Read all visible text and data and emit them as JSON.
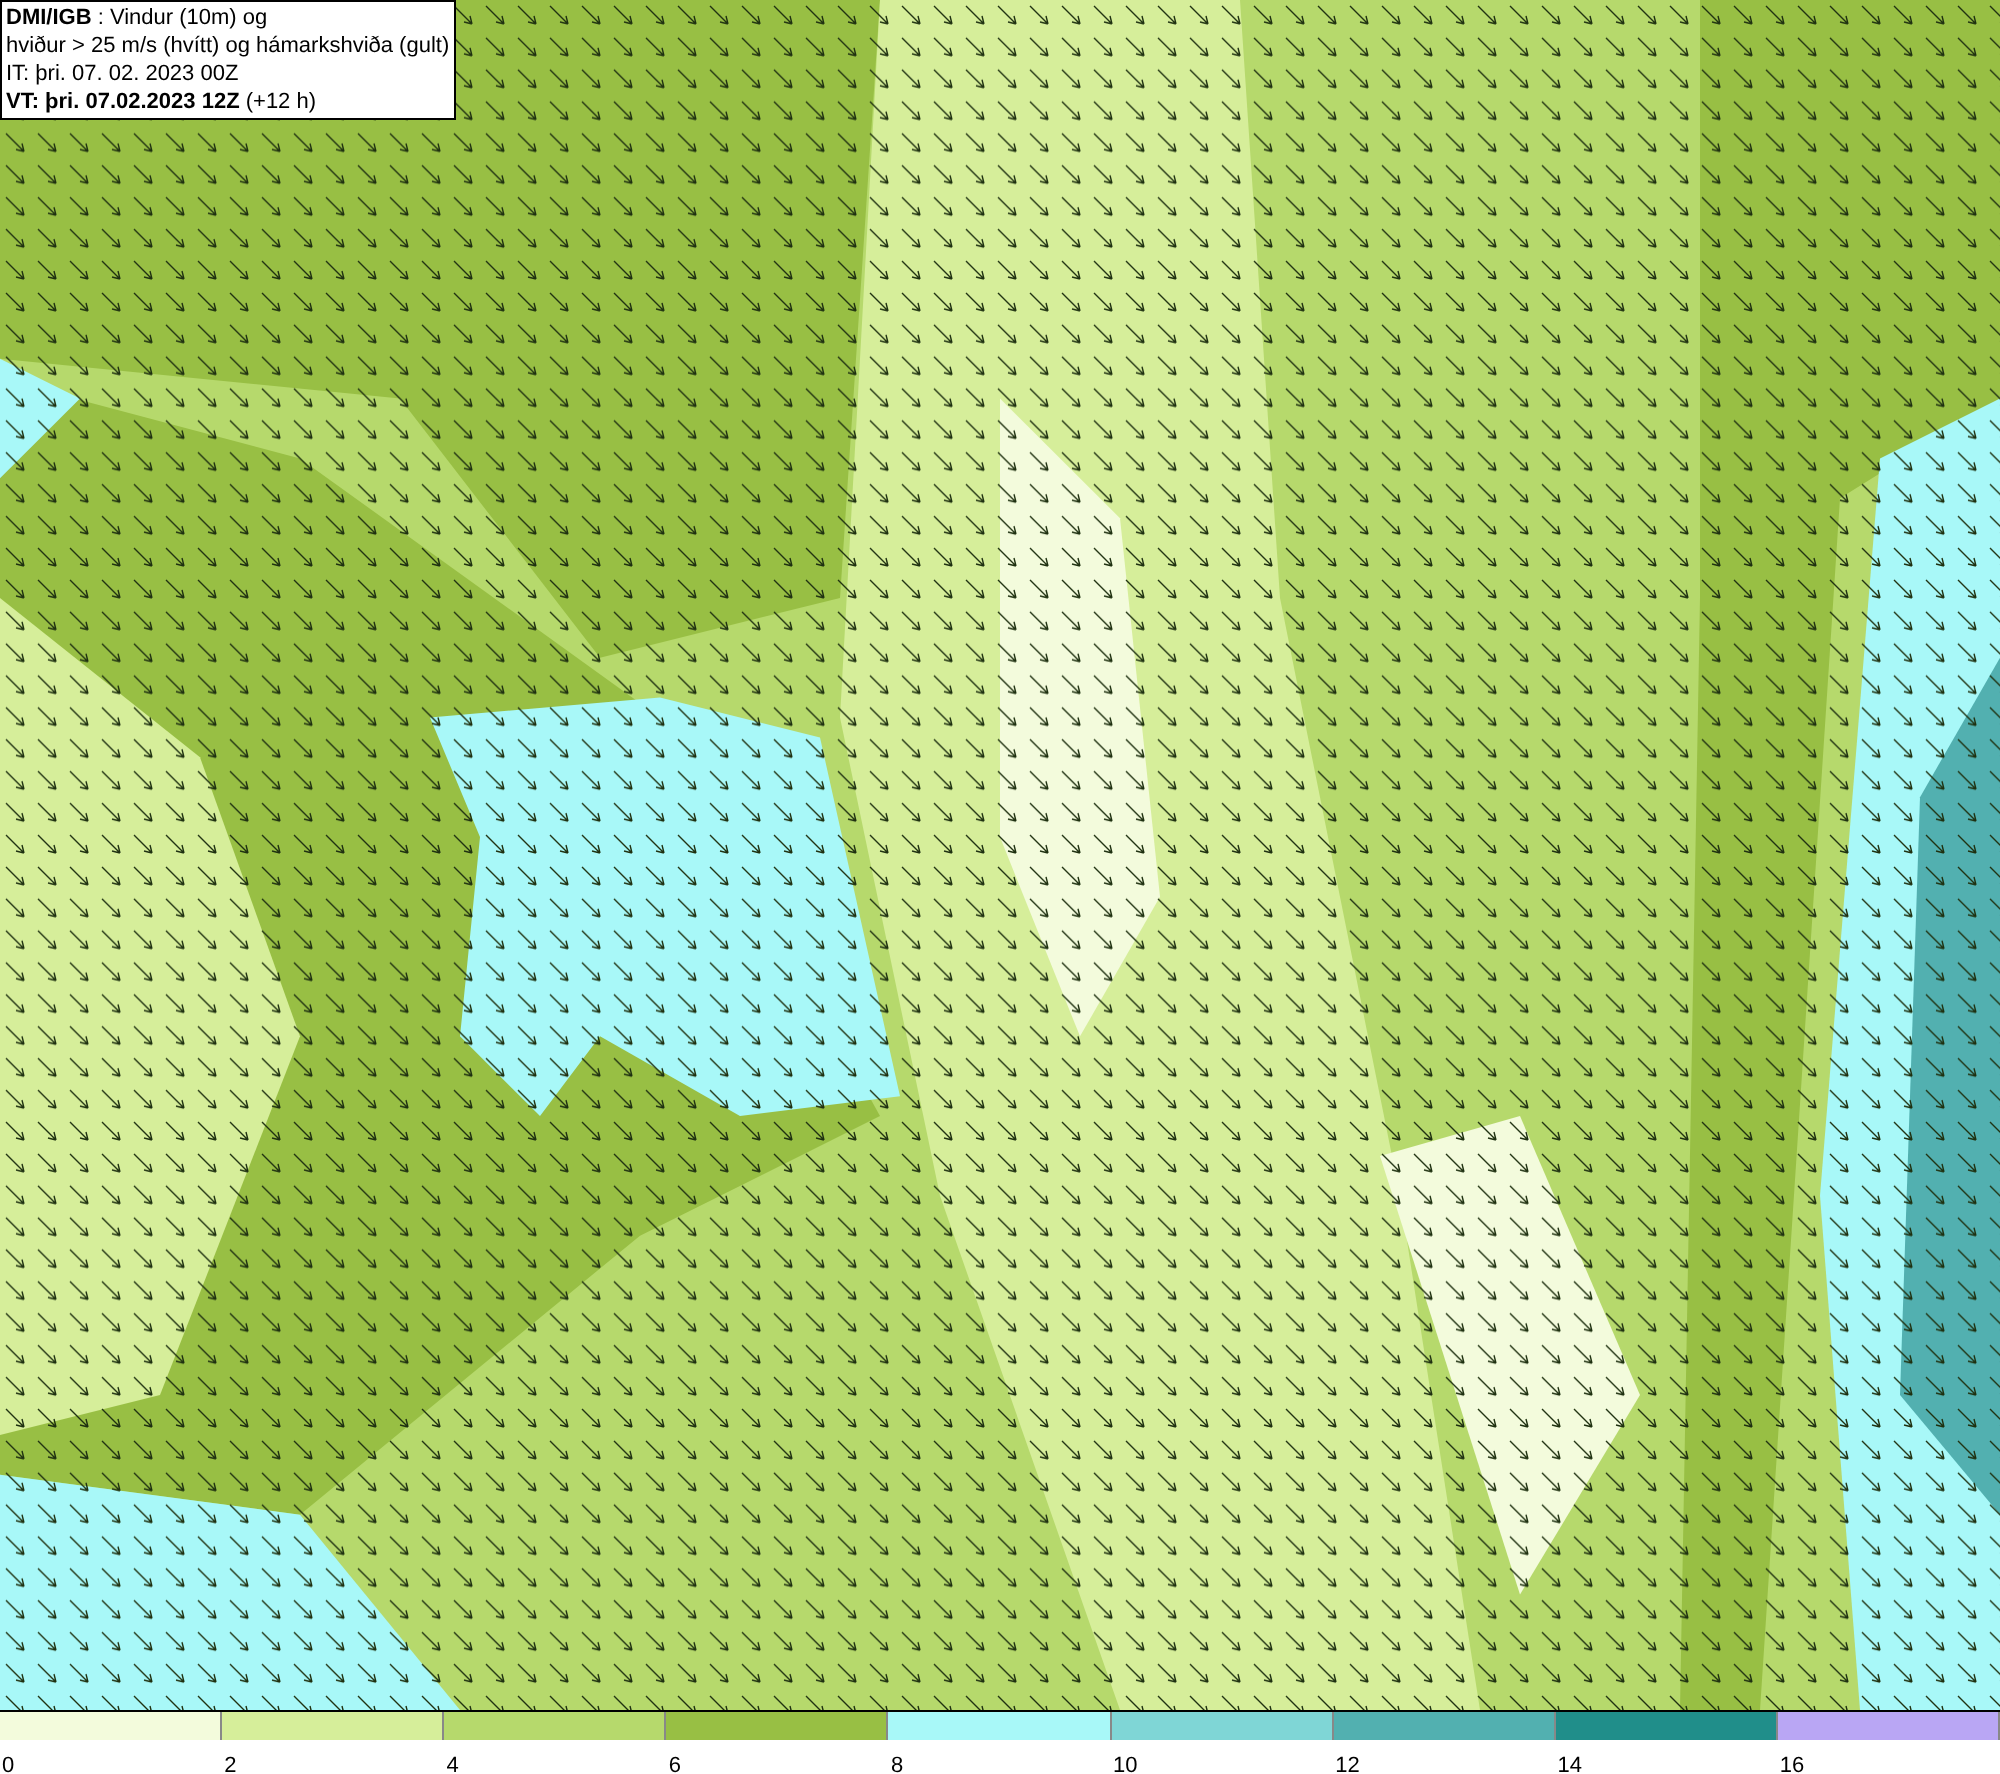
{
  "info_box": {
    "lines": [
      "**DMI/IGB** : Vindur (10m) og",
      "hviður > 25 m/s (hvítt) og hámarkshviða (gult)",
      "IT: þri. 07. 02. 2023 00Z",
      "**VT: þri. 07.02.2023 12Z** (+12 h)"
    ]
  },
  "legend": [
    {
      "label": "0",
      "color": "#f3fbdc"
    },
    {
      "label": "2",
      "color": "#d6ee9a"
    },
    {
      "label": "4",
      "color": "#b6d96c"
    },
    {
      "label": "6",
      "color": "#98bf44"
    },
    {
      "label": "8",
      "color": "#a8f8f8"
    },
    {
      "label": "10",
      "color": "#7fd6d6"
    },
    {
      "label": "12",
      "color": "#52b0b0"
    },
    {
      "label": "14",
      "color": "#208e8a"
    },
    {
      "label": "16",
      "color": "#b9a6f4"
    }
  ]
}
